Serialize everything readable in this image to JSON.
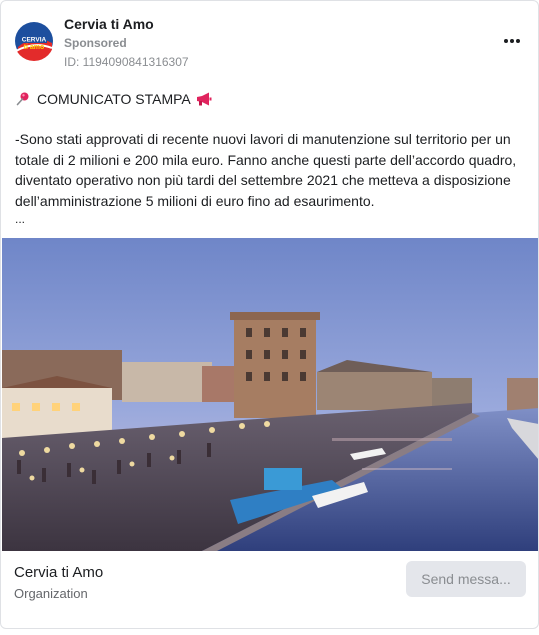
{
  "post": {
    "page_name": "Cervia ti Amo",
    "sponsored_label": "Sponsored",
    "ad_id": "ID: 1194090841316307",
    "avatar_logo_text": "CERVIA ti amo",
    "headline": "COMUNICATO STAMPA",
    "body": "-Sono stati approvati di recente nuovi lavori di manutenzione sul territorio per un totale di 2 milioni e 200 mila euro. Fanno anche questi parte dell’accordo quadro, diventato operativo non più tardi del settembre 2021 che metteva a disposizione dell’amministrazione 5 milioni di euro fino ad esaurimento.",
    "truncation": "..."
  },
  "footer": {
    "name": "Cervia ti Amo",
    "type": "Organization",
    "send_button": "Send messa..."
  },
  "icons": {
    "headline_prefix": "pushpin-icon",
    "headline_suffix": "loudspeaker-icon",
    "menu": "more-horizontal-icon"
  },
  "colors": {
    "secondary_text": "#8a8d91",
    "button_bg": "#e4e6eb",
    "border": "#dfe1e5"
  }
}
